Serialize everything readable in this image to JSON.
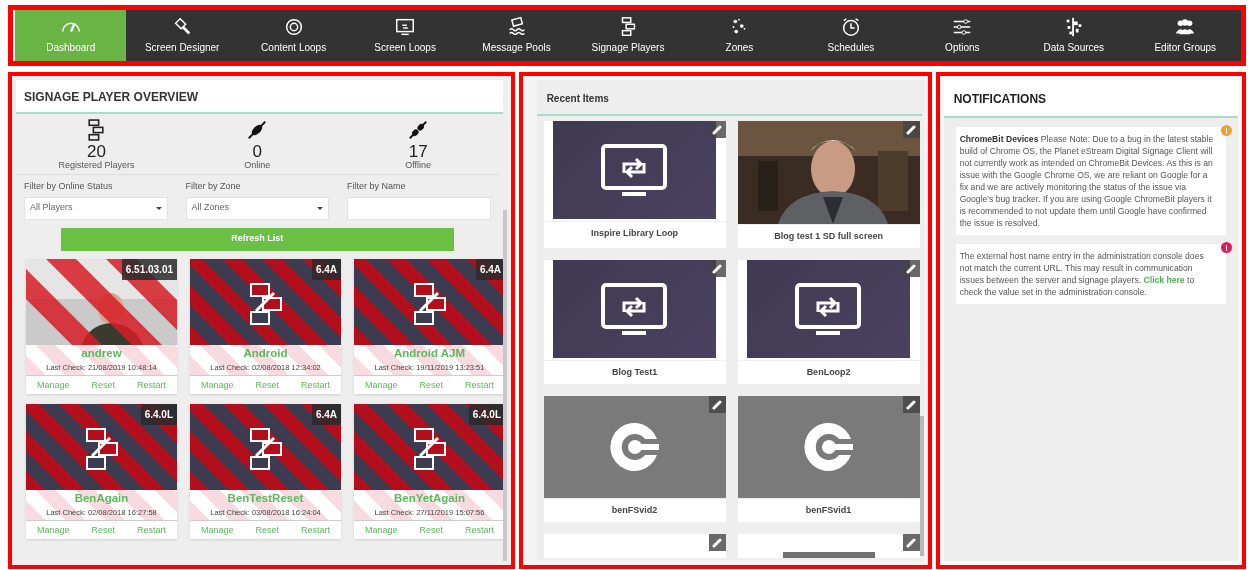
{
  "nav": {
    "tabs": [
      {
        "label": "Dashboard",
        "selected": true
      },
      {
        "label": "Screen Designer",
        "selected": false
      },
      {
        "label": "Content Loops",
        "selected": false
      },
      {
        "label": "Screen Loops",
        "selected": false
      },
      {
        "label": "Message Pools",
        "selected": false
      },
      {
        "label": "Signage Players",
        "selected": false
      },
      {
        "label": "Zones",
        "selected": false
      },
      {
        "label": "Schedules",
        "selected": false
      },
      {
        "label": "Options",
        "selected": false
      },
      {
        "label": "Data Sources",
        "selected": false
      },
      {
        "label": "Editor Groups",
        "selected": false
      }
    ]
  },
  "overview": {
    "title": "SIGNAGE PLAYER OVERVIEW",
    "stats": [
      {
        "value": "20",
        "label": "Registered Players"
      },
      {
        "value": "0",
        "label": "Online"
      },
      {
        "value": "17",
        "label": "Offline"
      }
    ],
    "filters": [
      {
        "label": "Filter by Online Status",
        "kind": "select",
        "value": "All Players"
      },
      {
        "label": "Filter by Zone",
        "kind": "select",
        "value": "All Zones"
      },
      {
        "label": "Filter by Name",
        "kind": "text"
      }
    ],
    "refresh_button": "Refresh List",
    "players": [
      {
        "name": "andrew",
        "version": "6.51.03.01",
        "last_check": "Last Check: 21/08/2019 10:48:14",
        "offline": true,
        "actions": [
          "Manage",
          "Reset",
          "Restart"
        ]
      },
      {
        "name": "Android",
        "version": "6.4A",
        "last_check": "Last Check: 02/08/2018 12:34:02",
        "kind": "device",
        "offline": true,
        "actions": [
          "Manage",
          "Reset",
          "Restart"
        ]
      },
      {
        "name": "Android AJM",
        "version": "6.4A",
        "last_check": "Last Check: 19/11/2019 13:23:51",
        "kind": "device",
        "offline": true,
        "actions": [
          "Manage",
          "Reset",
          "Restart"
        ]
      },
      {
        "name": "BenAgain",
        "version": "6.4.0L",
        "last_check": "Last Check: 02/08/2018 16:27:58",
        "kind": "device",
        "offline": true,
        "actions": [
          "Manage",
          "Reset",
          "Restart"
        ]
      },
      {
        "name": "BenTestReset",
        "version": "6.4A",
        "last_check": "Last Check: 03/08/2018 16:24:04",
        "kind": "device",
        "offline": true,
        "actions": [
          "Manage",
          "Reset",
          "Restart"
        ]
      },
      {
        "name": "BenYetAgain",
        "version": "6.4.0L",
        "last_check": "Last Check: 27/11/2019 15:07:56",
        "kind": "device",
        "offline": true,
        "actions": [
          "Manage",
          "Reset",
          "Restart"
        ]
      }
    ]
  },
  "recent": {
    "title": "Recent Items",
    "items": [
      {
        "kind": "loop",
        "label": "Inspire Library Loop"
      },
      {
        "kind": "video",
        "label": "Blog test 1 SD full screen"
      },
      {
        "kind": "loop",
        "label": "Blog Test1"
      },
      {
        "kind": "loop",
        "label": "BenLoop2"
      },
      {
        "kind": "stream",
        "label": "benFSvid2"
      },
      {
        "kind": "stream",
        "label": "benFSvid1"
      },
      {
        "kind": "empty"
      },
      {
        "kind": "bar"
      }
    ]
  },
  "notifications": {
    "title": "NOTIFICATIONS",
    "items": [
      {
        "color": "#f0a030",
        "text": "**ChromeBit Devices** Please Note: Due to a bug in the latest stable build of Chrome OS, the Planet eStream Digital Signage Client will not currently work as intended on ChromeBit Devices. As this is an issue with the Google Chrome OS, we are reliant on Google for a fix and we are actively monitoring the status of the issue via Google's bug tracker. If you are using Google ChromeBit players it is recommended to not update them until Google have confirmed the issue is resolved."
      },
      {
        "color": "#e0195a",
        "text": "The external host name entry in the administration console does not match the current URL. This may result in communication issues between the server and signage players.",
        "link": "Click here",
        "text_after": "to check the value set in the administration console."
      }
    ]
  }
}
